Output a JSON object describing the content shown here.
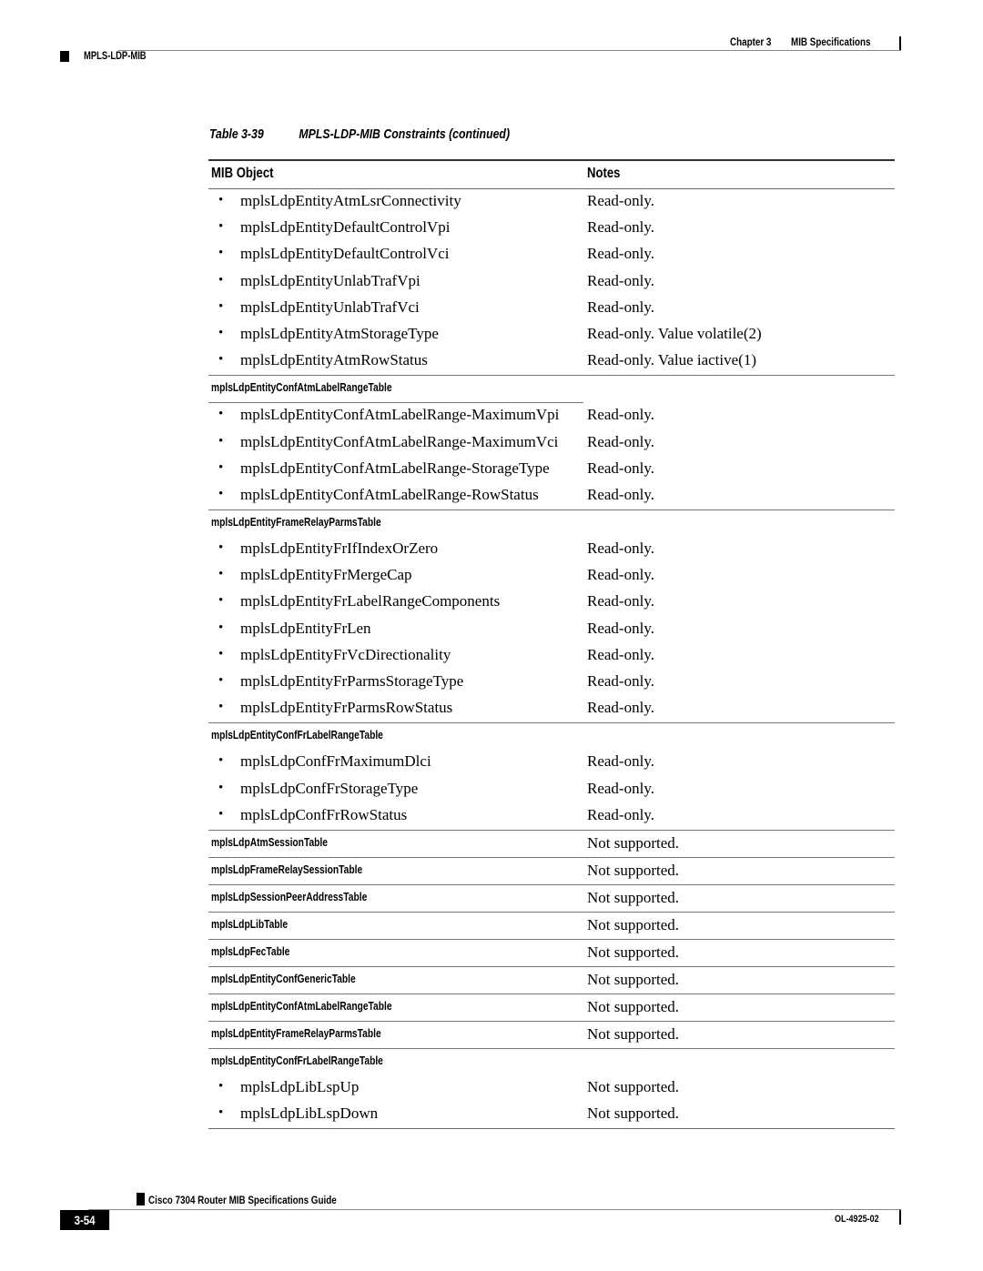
{
  "header": {
    "chapter": "Chapter 3",
    "chapter_title": "MIB Specifications",
    "section": "MPLS-LDP-MIB"
  },
  "caption": {
    "table_number": "Table 3-39",
    "title": "MPLS-LDP-MIB Constraints (continued)"
  },
  "table": {
    "columns": [
      "MIB Object",
      "Notes"
    ],
    "group1": [
      {
        "object": "mplsLdpEntityAtmLsrConnectivity",
        "note": "Read-only."
      },
      {
        "object": "mplsLdpEntityDefaultControlVpi",
        "note": "Read-only."
      },
      {
        "object": "mplsLdpEntityDefaultControlVci",
        "note": "Read-only."
      },
      {
        "object": "mplsLdpEntityUnlabTrafVpi",
        "note": "Read-only."
      },
      {
        "object": "mplsLdpEntityUnlabTrafVci",
        "note": "Read-only."
      },
      {
        "object": "mplsLdpEntityAtmStorageType",
        "note": "Read-only. Value volatile(2)"
      },
      {
        "object": "mplsLdpEntityAtmRowStatus",
        "note": "Read-only. Value iactive(1)"
      }
    ],
    "section2": {
      "name": "mplsLdpEntityConfAtmLabelRangeTable",
      "rows": [
        {
          "object": "mplsLdpEntityConfAtmLabelRange-MaximumVpi",
          "note": "Read-only."
        },
        {
          "object": "mplsLdpEntityConfAtmLabelRange-MaximumVci",
          "note": "Read-only."
        },
        {
          "object": "mplsLdpEntityConfAtmLabelRange-StorageType",
          "note": "Read-only."
        },
        {
          "object": "mplsLdpEntityConfAtmLabelRange-RowStatus",
          "note": "Read-only."
        }
      ]
    },
    "section3": {
      "name": "mplsLdpEntityFrameRelayParmsTable",
      "rows": [
        {
          "object": "mplsLdpEntityFrIfIndexOrZero",
          "note": "Read-only."
        },
        {
          "object": "mplsLdpEntityFrMergeCap",
          "note": "Read-only."
        },
        {
          "object": "mplsLdpEntityFrLabelRangeComponents",
          "note": "Read-only."
        },
        {
          "object": "mplsLdpEntityFrLen",
          "note": "Read-only."
        },
        {
          "object": "mplsLdpEntityFrVcDirectionality",
          "note": "Read-only."
        },
        {
          "object": "mplsLdpEntityFrParmsStorageType",
          "note": "Read-only."
        },
        {
          "object": "mplsLdpEntityFrParmsRowStatus",
          "note": "Read-only."
        }
      ]
    },
    "section4": {
      "name": "mplsLdpEntityConfFrLabelRangeTable",
      "rows": [
        {
          "object": "mplsLdpConfFrMaximumDlci",
          "note": "Read-only."
        },
        {
          "object": "mplsLdpConfFrStorageType",
          "note": "Read-only."
        },
        {
          "object": "mplsLdpConfFrRowStatus",
          "note": "Read-only."
        }
      ]
    },
    "table_rows": [
      {
        "name": "mplsLdpAtmSessionTable",
        "note": "Not supported."
      },
      {
        "name": "mplsLdpFrameRelaySessionTable",
        "note": "Not supported."
      },
      {
        "name": "mplsLdpSessionPeerAddressTable",
        "note": "Not supported."
      },
      {
        "name": "mplsLdpLibTable",
        "note": "Not supported."
      },
      {
        "name": "mplsLdpFecTable",
        "note": "Not supported."
      },
      {
        "name": "mplsLdpEntityConfGenericTable",
        "note": "Not supported."
      },
      {
        "name": "mplsLdpEntityConfAtmLabelRangeTable",
        "note": "Not supported."
      },
      {
        "name": "mplsLdpEntityFrameRelayParmsTable",
        "note": "Not supported."
      }
    ],
    "section5": {
      "name": "mplsLdpEntityConfFrLabelRangeTable",
      "rows": [
        {
          "object": "mplsLdpLibLspUp",
          "note": "Not supported."
        },
        {
          "object": "mplsLdpLibLspDown",
          "note": "Not supported."
        }
      ]
    }
  },
  "footer": {
    "guide_title": "Cisco 7304 Router MIB Specifications Guide",
    "page_number": "3-54",
    "doc_number": "OL-4925-02"
  }
}
